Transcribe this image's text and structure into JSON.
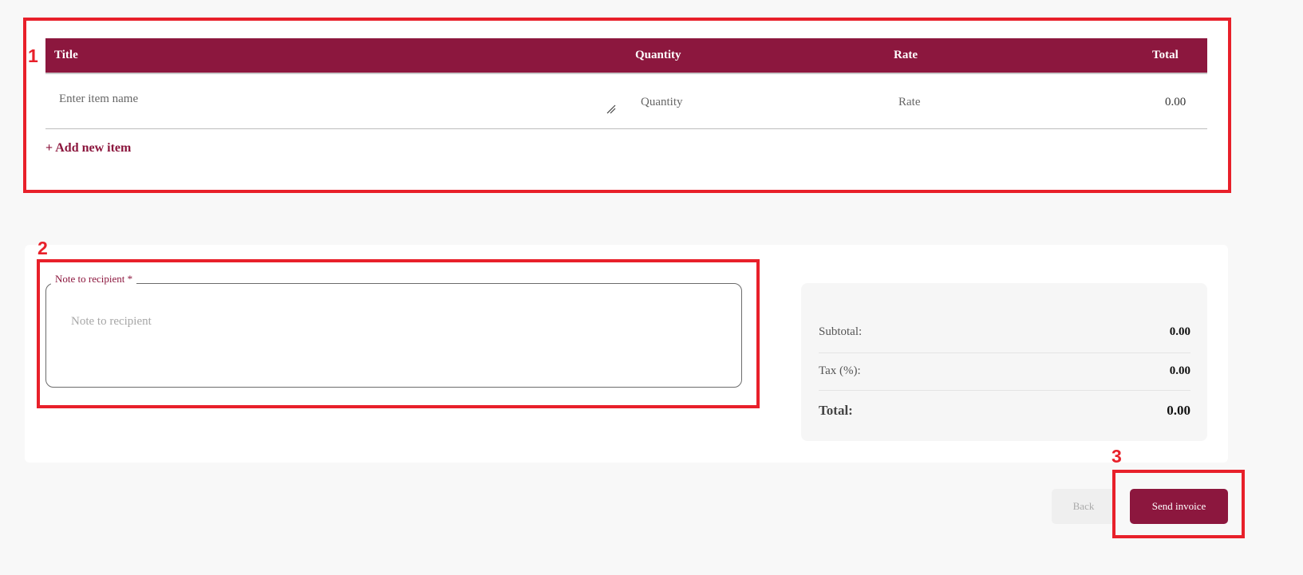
{
  "table": {
    "headers": {
      "title": "Title",
      "quantity": "Quantity",
      "rate": "Rate",
      "total": "Total"
    },
    "row": {
      "item_placeholder": "Enter item name",
      "quantity_placeholder": "Quantity",
      "rate_placeholder": "Rate",
      "total": "0.00"
    },
    "add_item_label": "+ Add new item"
  },
  "note": {
    "label": "Note to recipient *",
    "placeholder": "Note to recipient"
  },
  "summary": {
    "subtotal_label": "Subtotal:",
    "subtotal_value": "0.00",
    "tax_label": "Tax (%):",
    "tax_value": "0.00",
    "total_label": "Total:",
    "total_value": "0.00"
  },
  "buttons": {
    "back": "Back",
    "send": "Send invoice"
  },
  "markers": {
    "one": "1",
    "two": "2",
    "three": "3"
  },
  "colors": {
    "brand": "#8c173e",
    "marker": "#e8202a"
  }
}
